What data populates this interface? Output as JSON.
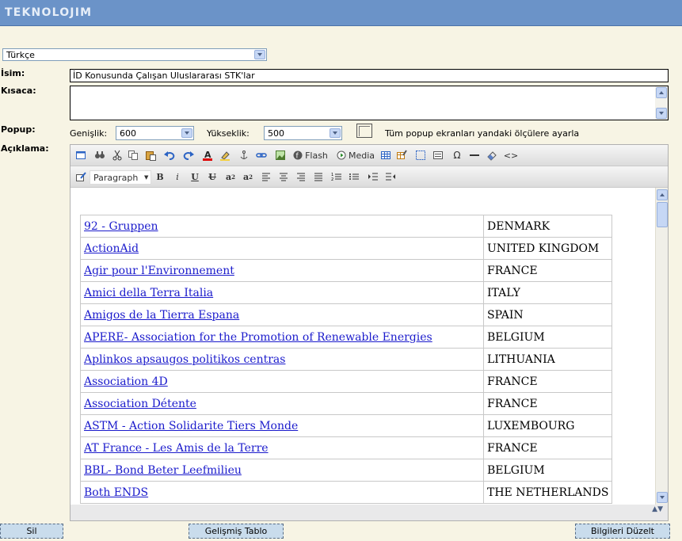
{
  "app": {
    "logo": "TEKNOLOJIM"
  },
  "language": {
    "selected": "Türkçe"
  },
  "name": {
    "label": "İsim:",
    "value": "İD Konusunda Çalışan Uluslararası STK'lar"
  },
  "short": {
    "label": "Kısaca:",
    "value": ""
  },
  "popup": {
    "label": "Popup:",
    "width_label": "Genişlik:",
    "width_value": "600",
    "height_label": "Yükseklik:",
    "height_value": "500",
    "all_label": "Tüm popup ekranları yandaki ölçülere ayarla",
    "all_checked": false
  },
  "description": {
    "label": "Açıklama:"
  },
  "toolbar": {
    "flash": "Flash",
    "media": "Media",
    "format": "Paragraph"
  },
  "organizations": [
    {
      "name": "92 - Gruppen",
      "country": "DENMARK"
    },
    {
      "name": "ActionAid",
      "country": "UNITED KINGDOM"
    },
    {
      "name": "Agir pour l'Environnement",
      "country": "FRANCE"
    },
    {
      "name": "Amici della Terra Italia",
      "country": "ITALY"
    },
    {
      "name": "Amigos de la Tierra Espana",
      "country": "SPAIN"
    },
    {
      "name": "APERE- Association for the Promotion of Renewable Energies",
      "country": "BELGIUM"
    },
    {
      "name": "Aplinkos apsaugos politikos centras",
      "country": "LITHUANIA"
    },
    {
      "name": "Association 4D",
      "country": "FRANCE"
    },
    {
      "name": "Association Détente",
      "country": "FRANCE"
    },
    {
      "name": "ASTM - Action Solidarite Tiers Monde",
      "country": "LUXEMBOURG"
    },
    {
      "name": "AT France - Les Amis de la Terre",
      "country": "FRANCE"
    },
    {
      "name": "BBL- Bond Beter Leefmilieu",
      "country": "BELGIUM"
    },
    {
      "name": "Both ENDS",
      "country": "THE NETHERLANDS"
    }
  ],
  "buttons": {
    "delete": "Sil",
    "advanced_table": "Gelişmiş Tablo",
    "update": "Bilgileri Düzelt"
  },
  "colors": {
    "header": "#6b93c8",
    "background": "#f7f4e4",
    "link": "#1b1bcc",
    "button": "#c9dcec"
  }
}
